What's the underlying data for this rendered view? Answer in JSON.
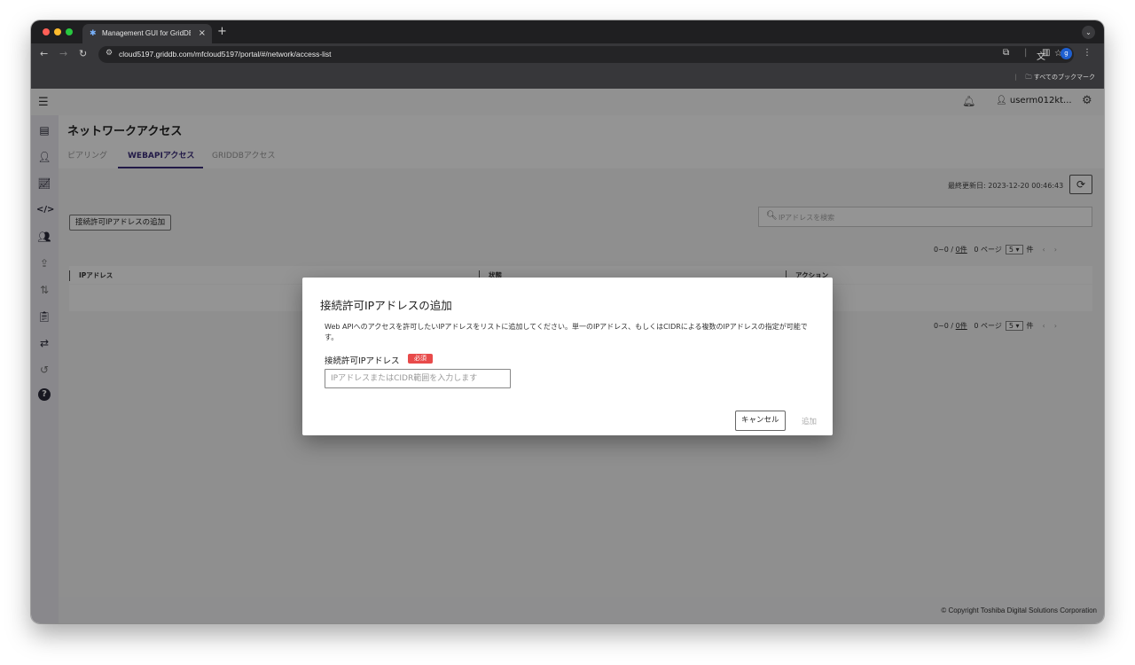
{
  "browser": {
    "tab_title": "Management GUI for GridDB",
    "tab_close": "×",
    "new_tab": "+",
    "url_host": "cloud5197.griddb.com",
    "url_path": "/mfcloud5197/portal/#/network/access-list",
    "bookmarks_label": "すべてのブックマーク",
    "profile_initial": "g"
  },
  "header": {
    "username": "userm012kt..."
  },
  "page": {
    "title": "ネットワークアクセス",
    "tabs": [
      {
        "label": "ピアリング",
        "active": false
      },
      {
        "label": "WEBAPIアクセス",
        "active": true
      },
      {
        "label": "GRIDDBアクセス",
        "active": false
      }
    ],
    "last_updated": "最終更新日: 2023-12-20 00:46:43",
    "add_button": "接続許可IPアドレスの追加",
    "search_placeholder": "IPアドレスを検索",
    "pager": {
      "range": "0~0 / ",
      "total": "0件",
      "page": "0 ページ",
      "per_page": "5",
      "unit": "件"
    },
    "columns": [
      "IPアドレス",
      "状態",
      "アクション"
    ]
  },
  "dialog": {
    "title": "接続許可IPアドレスの追加",
    "description": "Web APIへのアクセスを許可したいIPアドレスをリストに追加してください。単一のIPアドレス、もしくはCIDRによる複数のIPアドレスの指定が可能です。",
    "field_label": "接続許可IPアドレス",
    "required_badge": "必須",
    "input_placeholder": "IPアドレスまたはCIDR範囲を入力します",
    "input_value": "",
    "cancel_label": "キャンセル",
    "add_label": "追加"
  },
  "footer": {
    "copyright": "© Copyright Toshiba Digital Solutions Corporation"
  },
  "colors": {
    "accent": "#3b2d7a",
    "required": "#e84a4a"
  }
}
